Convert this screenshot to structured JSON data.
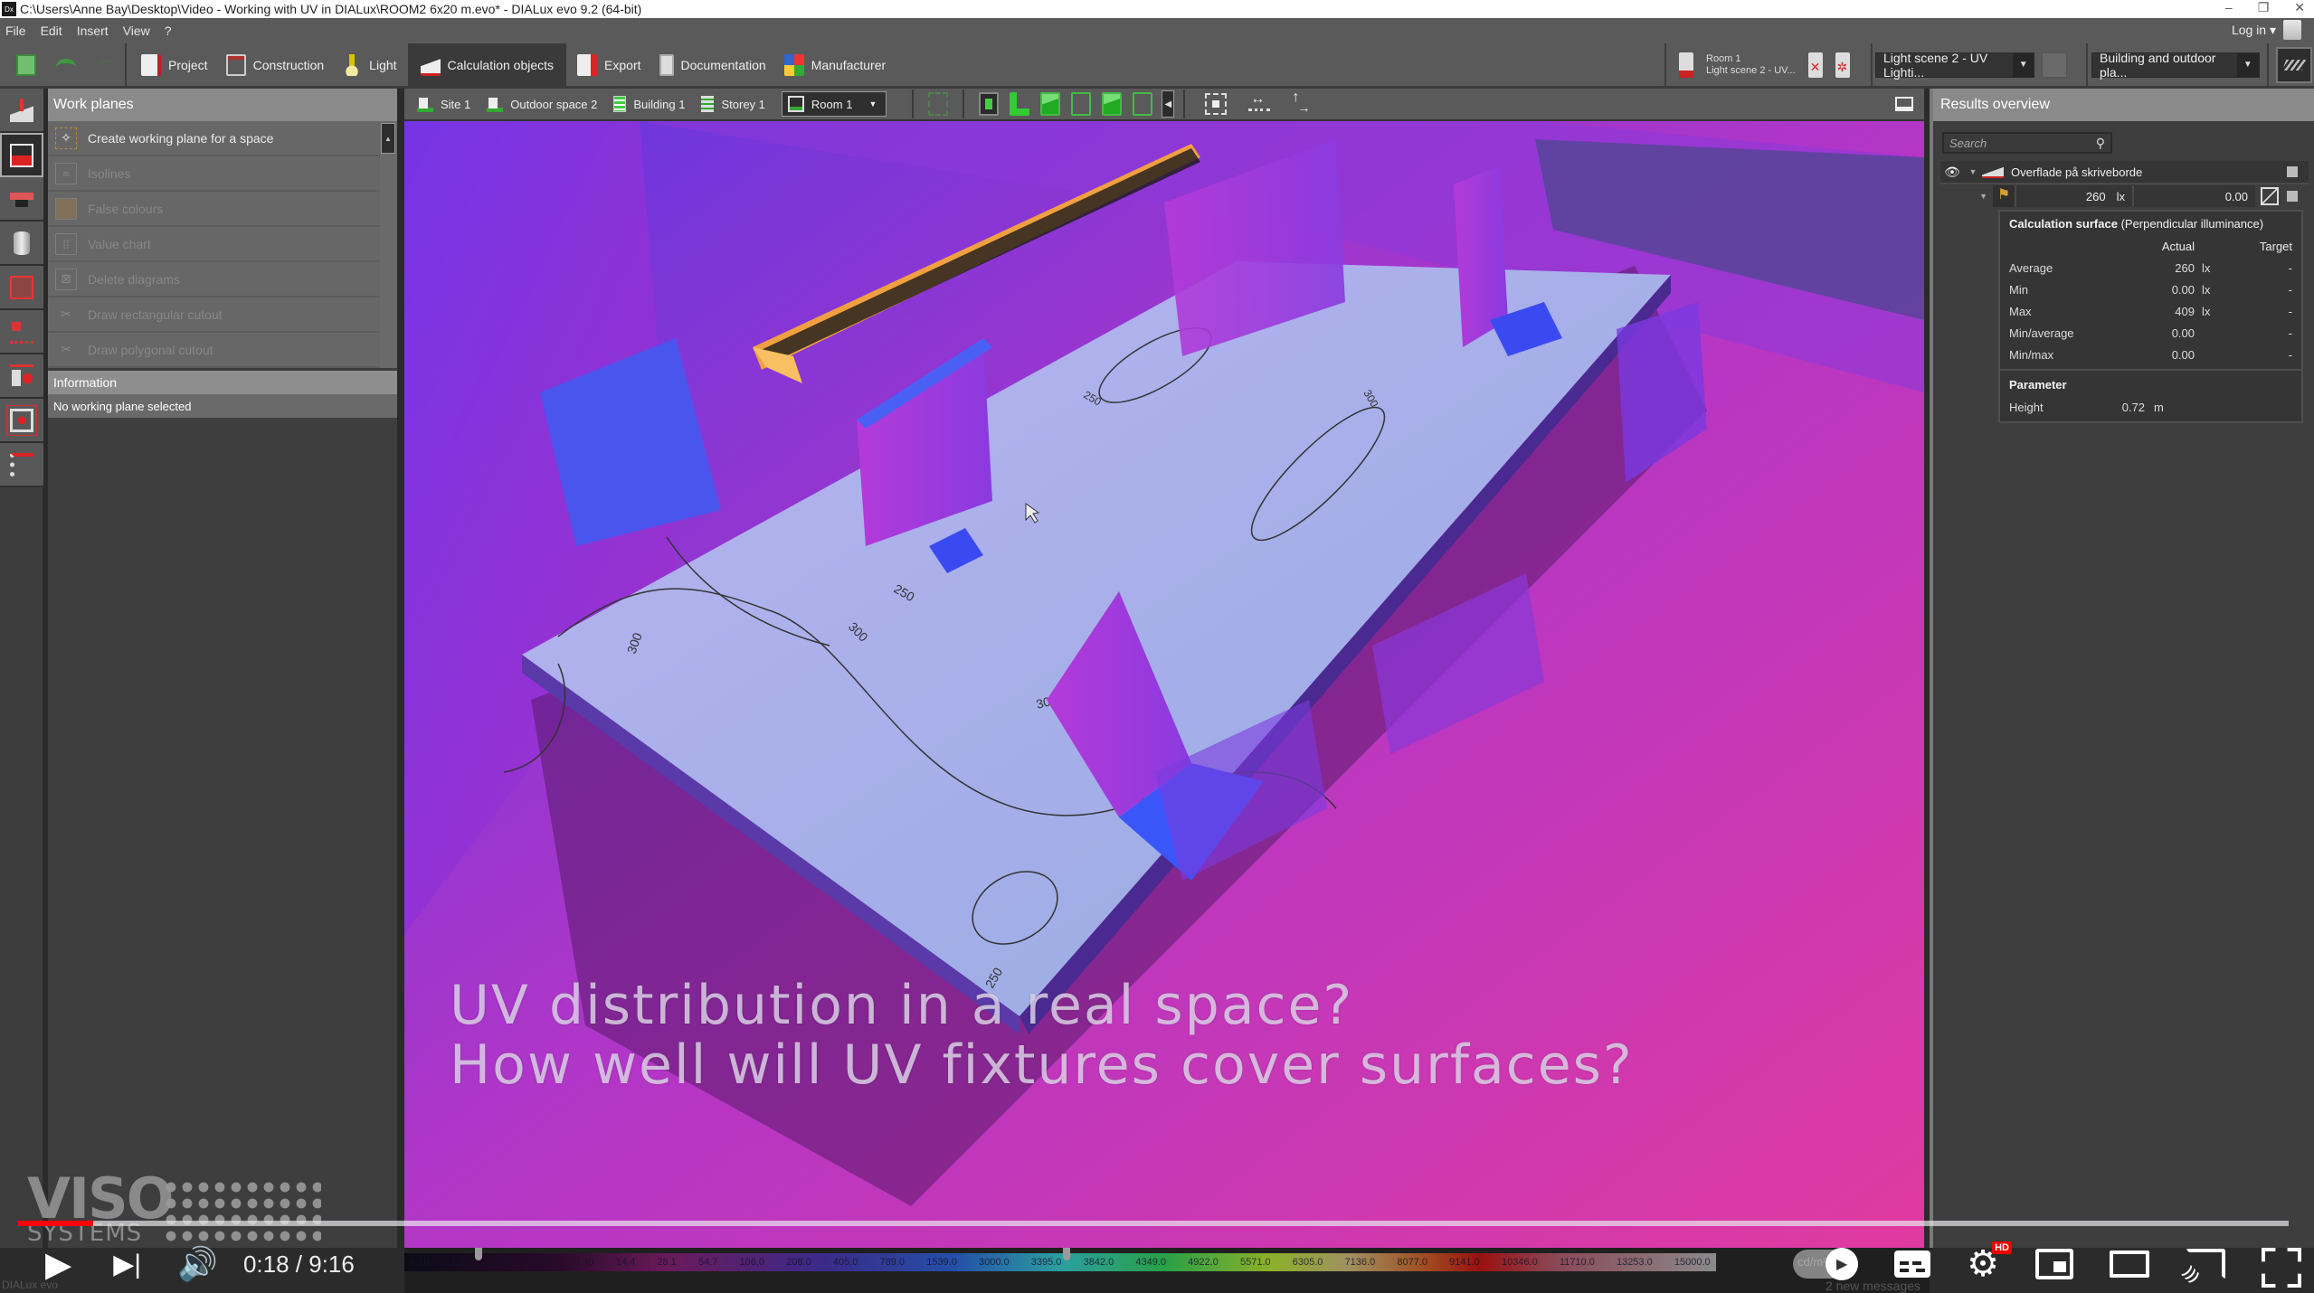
{
  "window": {
    "title": "C:\\Users\\Anne Bay\\Desktop\\Video - Working with UV in DIALux\\ROOM2 6x20 m.evo* - DIALux evo 9.2  (64-bit)",
    "app_icon": "Dx",
    "controls": [
      "–",
      "❐",
      "✕"
    ]
  },
  "menu": {
    "items": [
      "File",
      "Edit",
      "Insert",
      "View",
      "?"
    ],
    "login_label": "Log in ▾"
  },
  "toolbar": {
    "modes": [
      {
        "label": "Project",
        "icon": "project-icon"
      },
      {
        "label": "Construction",
        "icon": "construction-icon"
      },
      {
        "label": "Light",
        "icon": "light-icon"
      },
      {
        "label": "Calculation objects",
        "icon": "calculation-objects-icon",
        "active": true
      },
      {
        "label": "Export",
        "icon": "export-icon"
      },
      {
        "label": "Documentation",
        "icon": "documentation-icon"
      },
      {
        "label": "Manufacturer",
        "icon": "manufacturer-icon"
      }
    ],
    "scene_room": "Room 1",
    "scene_name": "Light scene 2 - UV...",
    "light_scene_select": "Light scene 2 - UV Lighti...",
    "view_select": "Building and outdoor pla..."
  },
  "left_panel": {
    "title": "Work planes",
    "items": [
      {
        "label": "Create working plane for a space",
        "enabled": true,
        "icon": "magic-wand-icon"
      },
      {
        "label": "Isolines",
        "enabled": false,
        "icon": "isolines-icon"
      },
      {
        "label": "False colours",
        "enabled": false,
        "icon": "false-colours-icon"
      },
      {
        "label": "Value chart",
        "enabled": false,
        "icon": "value-chart-icon"
      },
      {
        "label": "Delete diagrams",
        "enabled": false,
        "icon": "delete-diagrams-icon"
      },
      {
        "label": "Draw rectangular cutout",
        "enabled": false,
        "icon": "scissors-icon"
      },
      {
        "label": "Draw polygonal cutout",
        "enabled": false,
        "icon": "scissors-icon"
      }
    ],
    "info_title": "Information",
    "info_text": "No working plane selected"
  },
  "viewport_toolbar": {
    "breadcrumb": [
      "Site 1",
      "Outdoor space 2",
      "Building 1",
      "Storey 1"
    ],
    "room": "Room 1"
  },
  "viewport": {
    "isoline_labels": [
      "250",
      "300",
      "250",
      "300",
      "300",
      "250",
      "250",
      "300"
    ],
    "overlay_line1": "UV distribution in a real space?",
    "overlay_line2": "How well will UV fixtures cover surfaces?"
  },
  "results": {
    "title": "Results overview",
    "search_placeholder": "Search",
    "surface_name": "Overflade på skriveborde",
    "summary_value": "260",
    "summary_unit": "lx",
    "summary_uniformity": "0.00",
    "calc_title": "Calculation surface",
    "calc_subtitle": "(Perpendicular illuminance)",
    "col_actual": "Actual",
    "col_target": "Target",
    "rows": [
      {
        "label": "Average",
        "value": "260",
        "unit": "lx",
        "target": "-"
      },
      {
        "label": "Min",
        "value": "0.00",
        "unit": "lx",
        "target": "-"
      },
      {
        "label": "Max",
        "value": "409",
        "unit": "lx",
        "target": "-"
      },
      {
        "label": "Min/average",
        "value": "0.00",
        "unit": "",
        "target": "-"
      },
      {
        "label": "Min/max",
        "value": "0.00",
        "unit": "",
        "target": "-"
      }
    ],
    "param_title": "Parameter",
    "param_label": "Height",
    "param_value": "0.72",
    "param_unit": "m"
  },
  "legend": {
    "values": [
      "0.10",
      "1.00",
      "1.94",
      "3.79",
      "7.40",
      "14.4",
      "28.1",
      "54.7",
      "106.0",
      "208.0",
      "405.0",
      "789.0",
      "1539.0",
      "3000.0",
      "3395.0",
      "3842.0",
      "4349.0",
      "4922.0",
      "5571.0",
      "6305.0",
      "7136.0",
      "8077.0",
      "9141.0",
      "10346.0",
      "11710.0",
      "13253.0",
      "15000.0"
    ],
    "unit": "cd/m²",
    "messages": "2 new messages",
    "brand": "DIALux evo"
  },
  "video": {
    "logo_top": "VISO",
    "logo_bottom": "SYSTEMS",
    "current_time": "0:18",
    "duration": "9:16",
    "time_display": "0:18 / 9:16",
    "played_fraction": 0.033,
    "hd_badge": "HD"
  }
}
